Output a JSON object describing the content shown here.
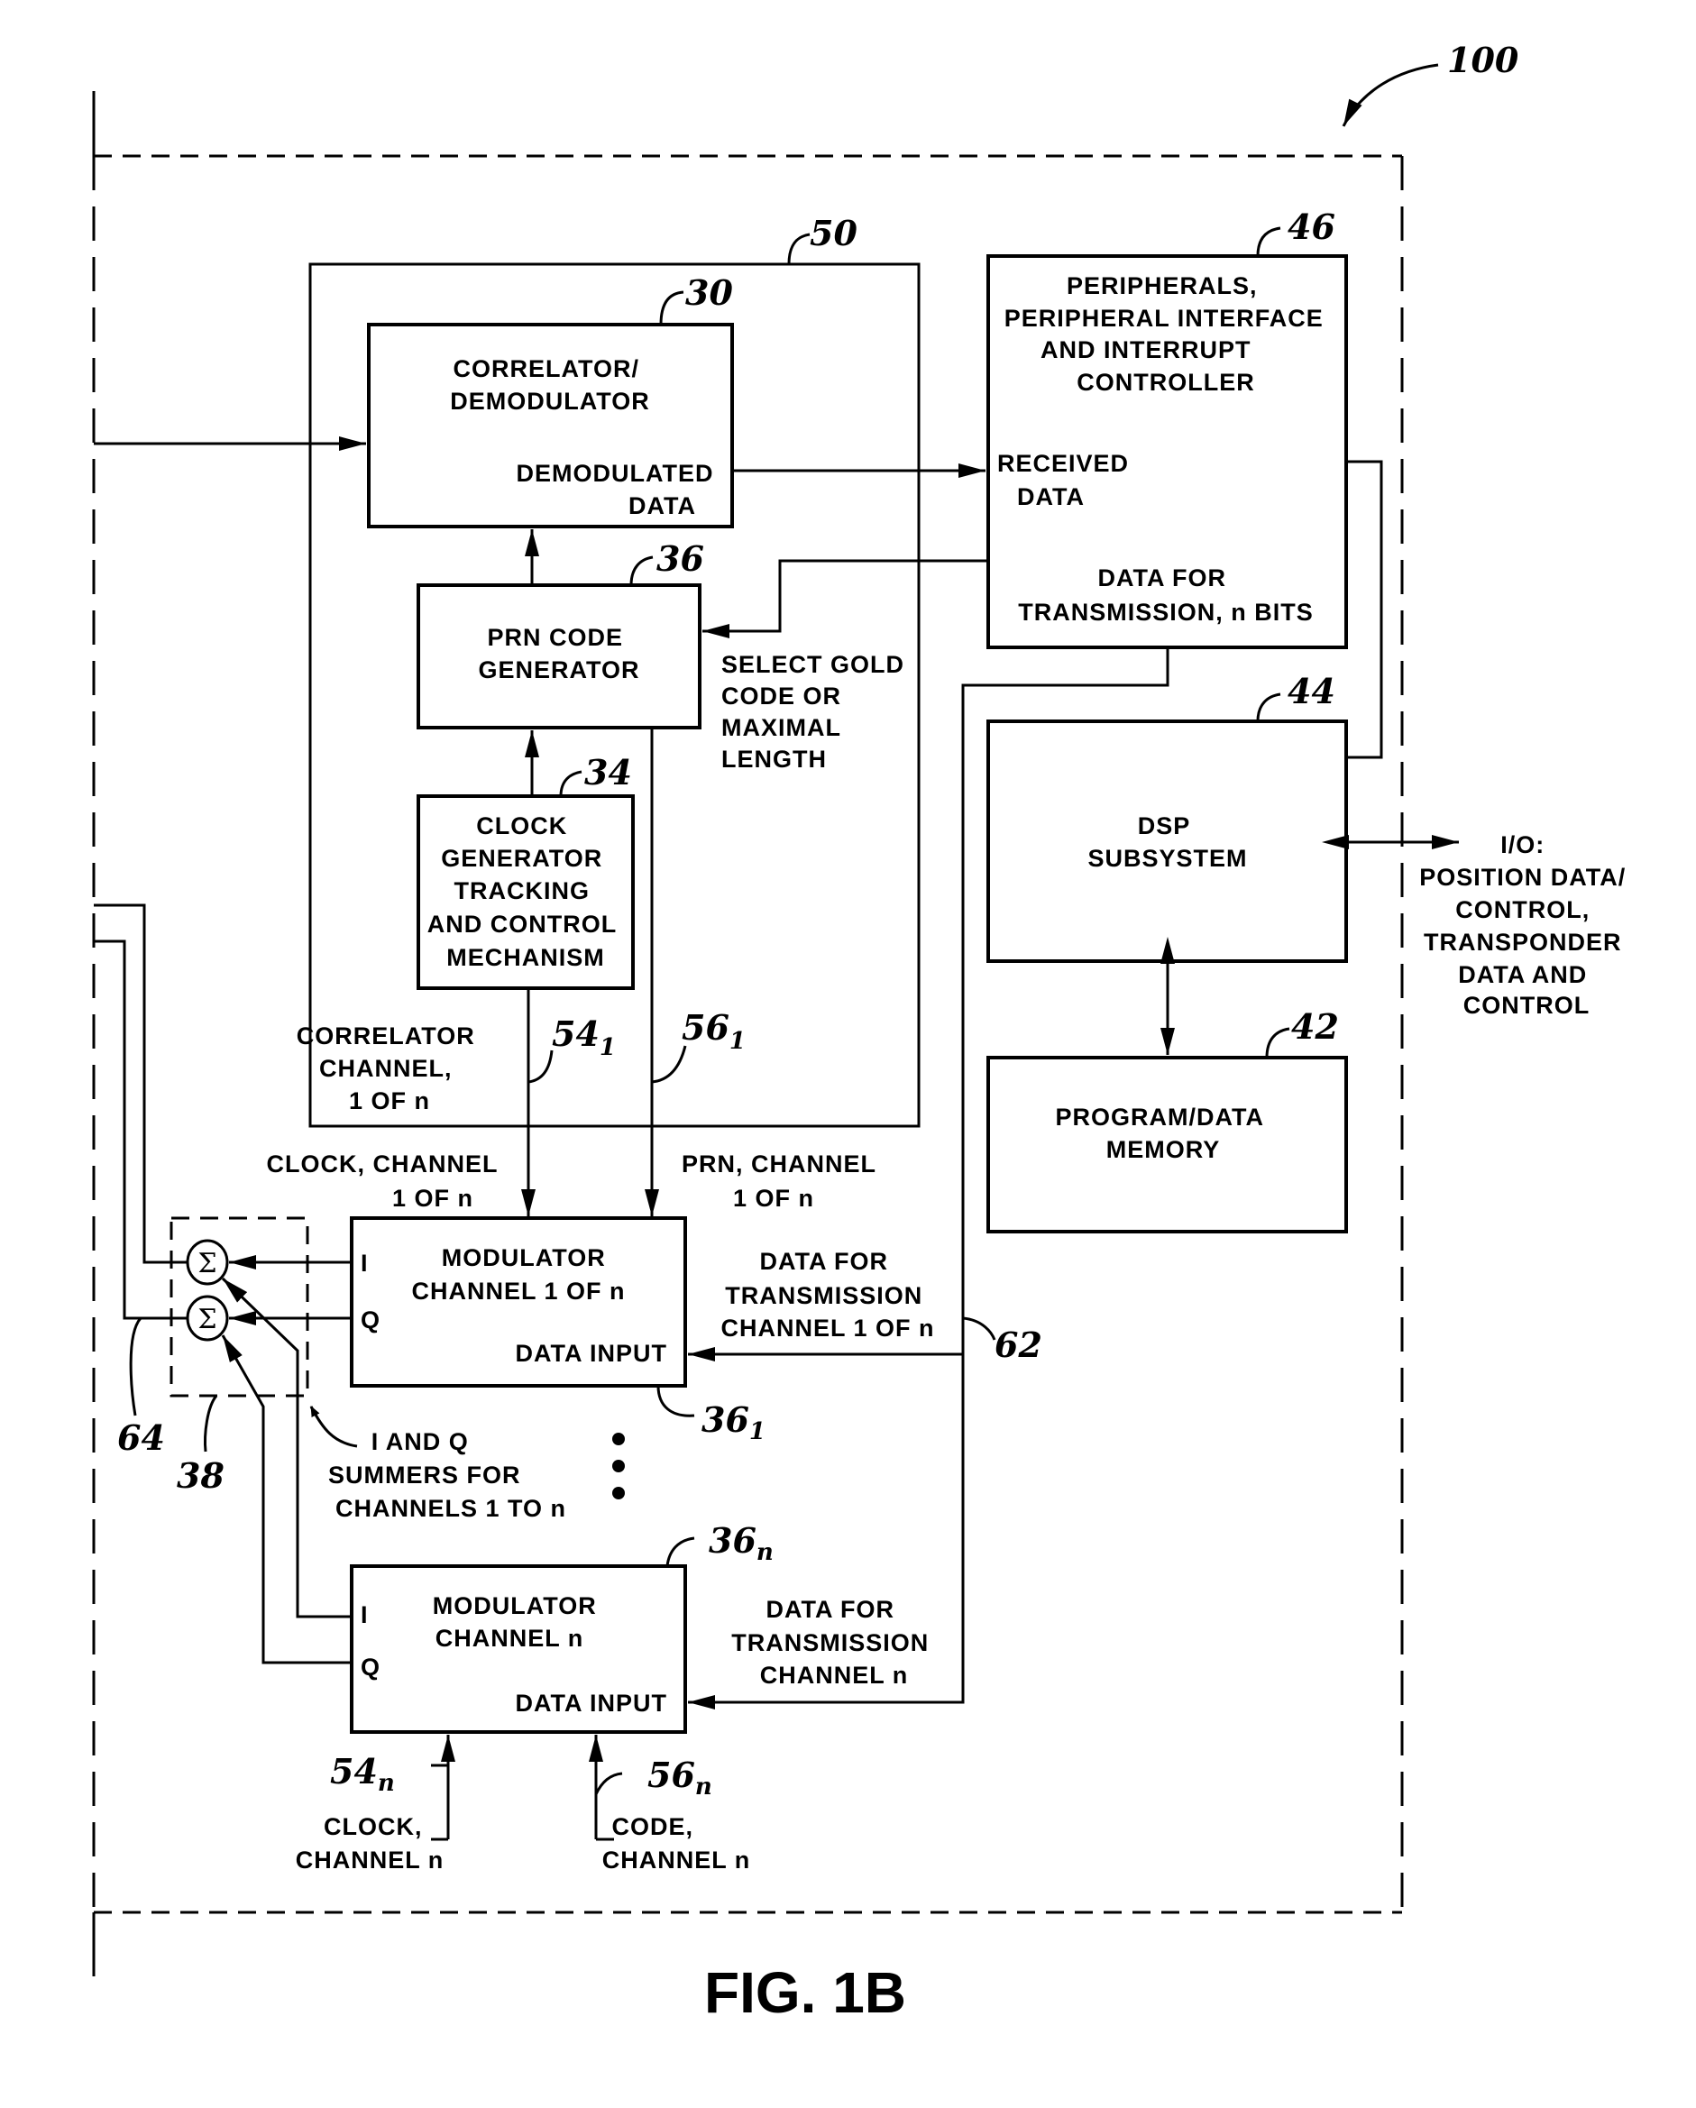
{
  "figure": {
    "caption": "FIG. 1B",
    "system_ref": "100"
  },
  "blocks": {
    "correlator_group": {
      "ref": "50",
      "label_lines": [
        "CORRELATOR",
        "CHANNEL,",
        "1 OF n"
      ]
    },
    "correlator": {
      "ref": "30",
      "title_lines": [
        "CORRELATOR/",
        "DEMODULATOR"
      ],
      "port_lines": [
        "DEMODULATED",
        "DATA"
      ]
    },
    "prn_generator": {
      "ref": "36",
      "title_lines": [
        "PRN CODE",
        "GENERATOR"
      ]
    },
    "clock_generator": {
      "ref": "34",
      "title_lines": [
        "CLOCK",
        "GENERATOR",
        "TRACKING",
        "AND CONTROL",
        "MECHANISM"
      ]
    },
    "peripherals": {
      "ref": "46",
      "title_lines": [
        "PERIPHERALS,",
        "PERIPHERAL INTERFACE",
        "AND INTERRUPT",
        "CONTROLLER"
      ],
      "input_lines": [
        "RECEIVED",
        "DATA"
      ],
      "output_lines": [
        "DATA FOR",
        "TRANSMISSION, n BITS"
      ]
    },
    "dsp": {
      "ref": "44",
      "title_lines": [
        "DSP",
        "SUBSYSTEM"
      ]
    },
    "memory": {
      "ref": "42",
      "title_lines": [
        "PROGRAM/DATA",
        "MEMORY"
      ]
    },
    "modulator_1": {
      "ref": "36",
      "ref_sub": "1",
      "title_lines": [
        "MODULATOR",
        "CHANNEL 1 OF n"
      ],
      "port_i": "I",
      "port_q": "Q",
      "data_port": "DATA INPUT"
    },
    "modulator_n": {
      "ref": "36",
      "ref_sub": "n",
      "title_lines": [
        "MODULATOR",
        "CHANNEL n"
      ],
      "port_i": "I",
      "port_q": "Q",
      "data_port": "DATA INPUT"
    },
    "summers": {
      "ref": "38",
      "symbol": "Σ",
      "output_ref": "64",
      "label_lines": [
        "I AND Q",
        "SUMMERS FOR",
        "CHANNELS 1 TO n"
      ]
    }
  },
  "signals": {
    "select_code_lines": [
      "SELECT GOLD",
      "CODE OR",
      "MAXIMAL",
      "LENGTH"
    ],
    "clock_ch1": {
      "ref": "54",
      "ref_sub": "1",
      "label_lines": [
        "CLOCK, CHANNEL",
        "1 OF n"
      ]
    },
    "prn_ch1": {
      "ref": "56",
      "ref_sub": "1",
      "label_lines": [
        "PRN, CHANNEL",
        "1 OF n"
      ]
    },
    "data_ch1": {
      "ref": "62",
      "label_lines": [
        "DATA FOR",
        "TRANSMISSION",
        "CHANNEL 1 OF n"
      ]
    },
    "data_chn": {
      "label_lines": [
        "DATA FOR",
        "TRANSMISSION",
        "CHANNEL n"
      ]
    },
    "clock_chn": {
      "ref": "54",
      "ref_sub": "n",
      "label_lines": [
        "CLOCK,",
        "CHANNEL n"
      ]
    },
    "code_chn": {
      "ref": "56",
      "ref_sub": "n",
      "label_lines": [
        "CODE,",
        "CHANNEL n"
      ]
    },
    "io": {
      "label_lines": [
        "I/O:",
        "POSITION DATA/",
        "CONTROL,",
        "TRANSPONDER",
        "DATA AND",
        "CONTROL"
      ]
    },
    "ellipsis": "⋮"
  }
}
